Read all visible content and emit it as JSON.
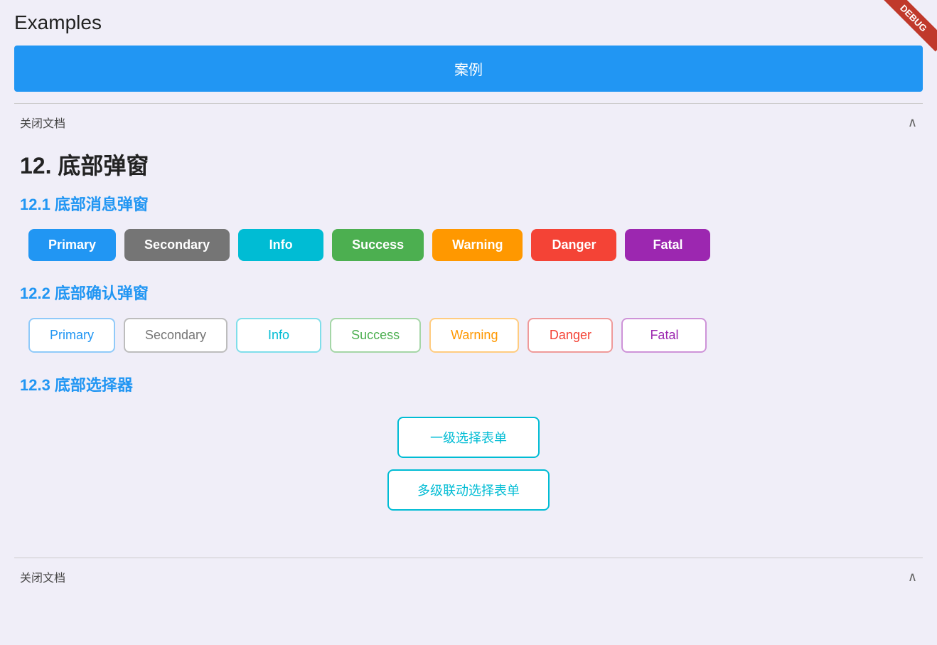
{
  "debug": {
    "label": "DEBUG"
  },
  "page": {
    "title": "Examples"
  },
  "banner": {
    "text": "案例"
  },
  "top_section": {
    "close_label": "关闭文档",
    "chevron": "∧"
  },
  "main_heading": {
    "text": "12. 底部弹窗"
  },
  "subsection_1": {
    "title": "12.1 底部消息弹窗",
    "buttons": [
      {
        "label": "Primary",
        "style": "primary"
      },
      {
        "label": "Secondary",
        "style": "secondary"
      },
      {
        "label": "Info",
        "style": "info"
      },
      {
        "label": "Success",
        "style": "success"
      },
      {
        "label": "Warning",
        "style": "warning"
      },
      {
        "label": "Danger",
        "style": "danger"
      },
      {
        "label": "Fatal",
        "style": "fatal"
      }
    ]
  },
  "subsection_2": {
    "title": "12.2 底部确认弹窗",
    "buttons": [
      {
        "label": "Primary",
        "style": "primary"
      },
      {
        "label": "Secondary",
        "style": "secondary"
      },
      {
        "label": "Info",
        "style": "info"
      },
      {
        "label": "Success",
        "style": "success"
      },
      {
        "label": "Warning",
        "style": "warning"
      },
      {
        "label": "Danger",
        "style": "danger"
      },
      {
        "label": "Fatal",
        "style": "fatal"
      }
    ]
  },
  "subsection_3": {
    "title": "12.3 底部选择器",
    "btn1": "一级选择表单",
    "btn2": "多级联动选择表单"
  },
  "bottom_section": {
    "close_label": "关闭文档",
    "chevron": "∧"
  }
}
